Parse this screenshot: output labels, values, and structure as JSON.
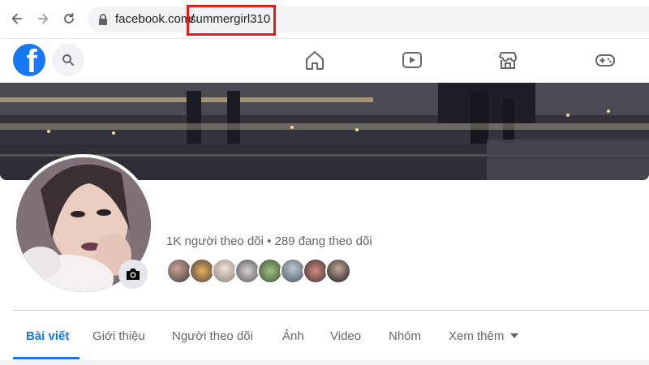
{
  "browser": {
    "back_icon": "back-arrow-icon",
    "forward_icon": "forward-arrow-icon",
    "reload_icon": "reload-icon",
    "lock_icon": "lock-icon",
    "url_host": "facebook.com/",
    "url_path": "summergirl310",
    "highlight_color": "#e01b1b"
  },
  "header": {
    "logo_letter": "f",
    "brand_color": "#1877f2",
    "search_icon": "search-icon",
    "nav_icons": [
      "home-icon",
      "watch-video-icon",
      "marketplace-icon",
      "gaming-icon"
    ]
  },
  "profile": {
    "stats_text": "1K người theo dõi • 289 đang theo dõi",
    "camera_icon": "camera-icon",
    "friend_avatar_count": 8
  },
  "tabs": [
    {
      "label": "Bài viết",
      "active": true
    },
    {
      "label": "Giới thiệu",
      "active": false
    },
    {
      "label": "Người theo dõi",
      "active": false
    },
    {
      "label": "Ảnh",
      "active": false
    },
    {
      "label": "Video",
      "active": false
    },
    {
      "label": "Nhóm",
      "active": false
    },
    {
      "label": "Xem thêm",
      "active": false,
      "has_dropdown": true
    }
  ]
}
